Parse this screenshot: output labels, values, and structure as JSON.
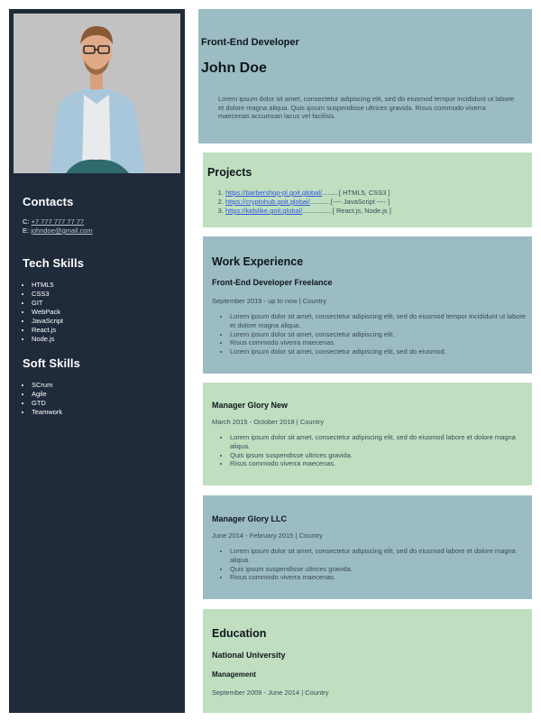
{
  "sidebar": {
    "contacts_title": "Contacts",
    "phone_prefix": "C:",
    "phone": "+7 777 777 77 77",
    "email_prefix": "E:",
    "email": "johndoe@gmail.com",
    "tech_title": "Tech Skills",
    "tech_skills": [
      "HTML5",
      "CSS3",
      "GIT",
      "WebPack",
      "JavaScript",
      "React.js",
      "Node.js"
    ],
    "soft_title": "Soft Skills",
    "soft_skills": [
      "SCrum",
      "Agile",
      "GTD",
      "Teamwork"
    ]
  },
  "header": {
    "role": "Front-End Developer",
    "name": "John Doe",
    "summary": "Lorem ipsum dolor sit amet, consectetur adipiscing elit, sed do eiusmod tempor incididunt ut labore et dolore magna aliqua. Quis ipsum suspendisse ultrices gravida. Risus commodo viverra maecenas accumsan lacus vel facilisis."
  },
  "projects": {
    "title": "Projects",
    "items": [
      {
        "link": "https://barbershop-pl.goit.global/",
        "sep": ".........[ HTML5, CSS3 ]"
      },
      {
        "link": "https://cryptohub.goit.global/",
        "sep": "...........[---- JavaScript ---- ]"
      },
      {
        "link": "https://kidslike.goit.global/",
        "sep": "................[ React.js, Node.js ]"
      }
    ]
  },
  "work": {
    "title": "Work Experience",
    "jobs": [
      {
        "position": "Front-End Developer Freelance",
        "period": "September 2019 - up to now | Country",
        "points": [
          "Lorem ipsum dolor sit amet, consectetur adipiscing elit, sed do eiusmod tempor incididunt ut labore et dolore magna aliqua.",
          "Lorem ipsum dolor sit amet, consectetur adipiscing elit.",
          "Risus commodo viverra maecenas.",
          "Lorem ipsum dolor sit amet, consectetur adipiscing elit, sed do eiusmod."
        ]
      },
      {
        "position": "Manager Glory New",
        "period": "March 2015 - October 2018 | Country",
        "points": [
          "Lorem ipsum dolor sit amet, consectetur adipiscing elit, sed do eiusmod labore et dolore magna aliqua.",
          "Quis ipsum suspendisse ultrices gravida.",
          "Risus commodo viverra maecenas."
        ]
      },
      {
        "position": "Manager Glory LLC",
        "period": "June 2014 - February 2015 | Country",
        "points": [
          "Lorem ipsum dolor sit amet, consectetur adipiscing elit, sed do eiusmod labore et dolore magna aliqua.",
          "Quis ipsum suspendisse ultrices gravida.",
          "Risus commodo viverra maecenas."
        ]
      }
    ]
  },
  "education": {
    "title": "Education",
    "school": "National University",
    "field": "Management",
    "period": "September 2009 - June 2014 | Country"
  }
}
